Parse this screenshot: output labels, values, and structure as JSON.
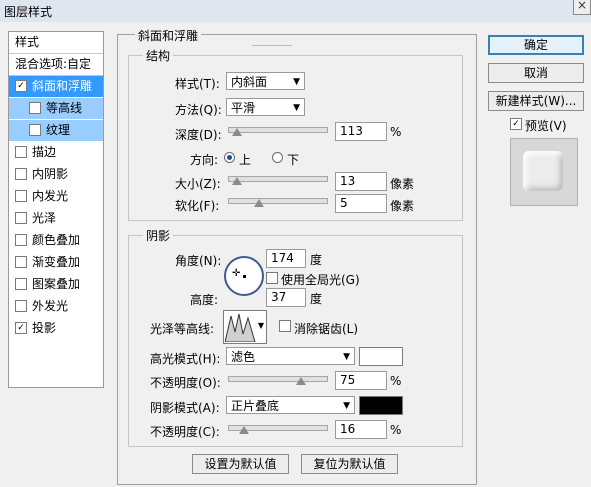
{
  "window": {
    "title": "图层样式"
  },
  "left_panel": {
    "header": "样式",
    "blend_options": "混合选项:自定",
    "items": [
      {
        "label": "斜面和浮雕",
        "checked": true,
        "state": "selected"
      },
      {
        "label": "等高线",
        "checked": false,
        "state": "sub"
      },
      {
        "label": "纹理",
        "checked": false,
        "state": "sub"
      },
      {
        "label": "描边",
        "checked": false
      },
      {
        "label": "内阴影",
        "checked": false
      },
      {
        "label": "内发光",
        "checked": false
      },
      {
        "label": "光泽",
        "checked": false
      },
      {
        "label": "颜色叠加",
        "checked": false
      },
      {
        "label": "渐变叠加",
        "checked": false
      },
      {
        "label": "图案叠加",
        "checked": false
      },
      {
        "label": "外发光",
        "checked": false
      },
      {
        "label": "投影",
        "checked": true
      }
    ]
  },
  "bevel": {
    "title": "斜面和浮雕",
    "structure": {
      "title": "结构",
      "style_label": "样式(T):",
      "style_value": "内斜面",
      "method_label": "方法(Q):",
      "method_value": "平滑",
      "depth_label": "深度(D):",
      "depth_value": "113",
      "depth_unit": "%",
      "depth_slider": 0.08,
      "direction_label": "方向:",
      "dir_up": "上",
      "dir_down": "下",
      "size_label": "大小(Z):",
      "size_value": "13",
      "size_unit": "像素",
      "size_slider": 0.05,
      "soften_label": "软化(F):",
      "soften_value": "5",
      "soften_unit": "像素",
      "soften_slider": 0.3
    },
    "shading": {
      "title": "阴影",
      "angle_label": "角度(N):",
      "angle_value": "174",
      "angle_unit": "度",
      "global_light_label": "使用全局光(G)",
      "altitude_label": "高度:",
      "altitude_value": "37",
      "altitude_unit": "度",
      "gloss_label": "光泽等高线:",
      "antialias_label": "消除锯齿(L)",
      "highlight_mode_label": "高光模式(H):",
      "highlight_mode_value": "滤色",
      "highlight_color": "#ffffff",
      "highlight_opacity_label": "不透明度(O):",
      "highlight_opacity_value": "75",
      "highlight_opacity_unit": "%",
      "highlight_opacity_slider": 0.75,
      "shadow_mode_label": "阴影模式(A):",
      "shadow_mode_value": "正片叠底",
      "shadow_color": "#000000",
      "shadow_opacity_label": "不透明度(C):",
      "shadow_opacity_value": "16",
      "shadow_opacity_unit": "%",
      "shadow_opacity_slider": 0.16
    },
    "set_default": "设置为默认值",
    "reset_default": "复位为默认值"
  },
  "buttons": {
    "ok": "确定",
    "cancel": "取消",
    "new_style": "新建样式(W)...",
    "preview": "预览(V)"
  }
}
